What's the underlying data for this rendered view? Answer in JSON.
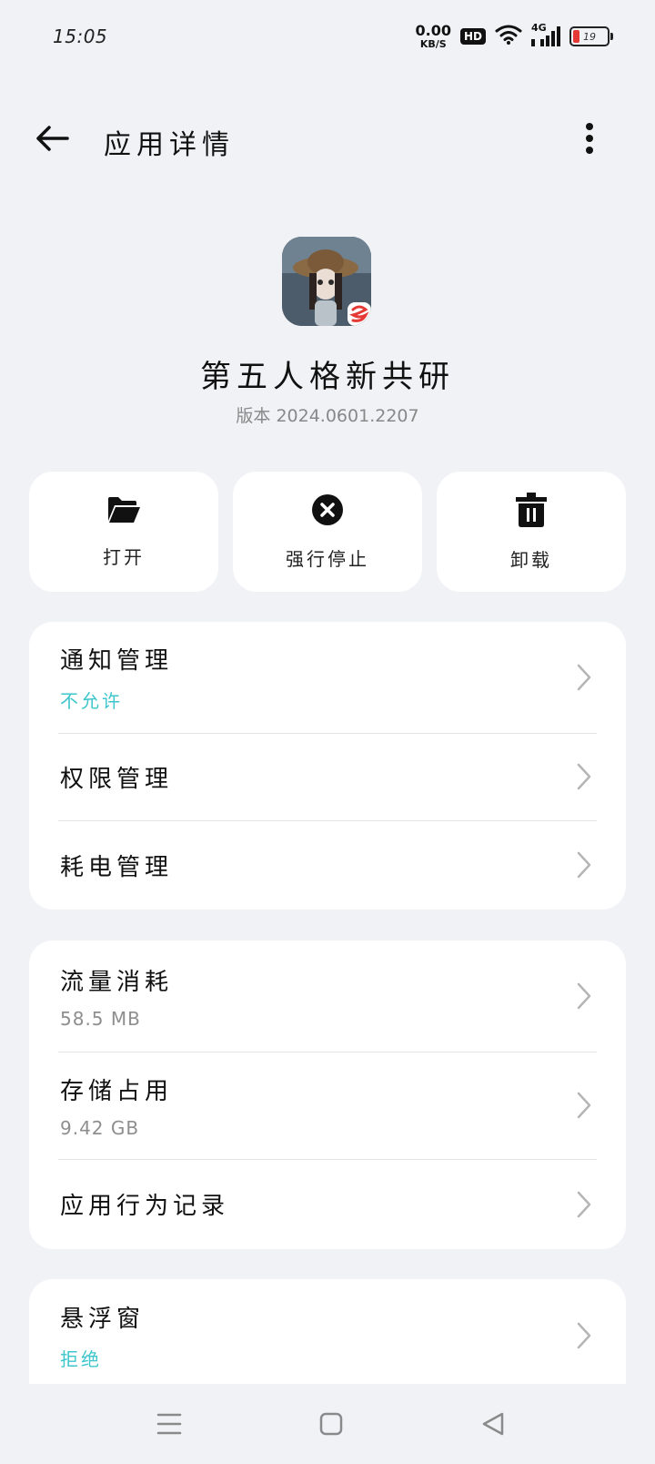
{
  "status_bar": {
    "time": "15:05",
    "net_speed_value": "0.00",
    "net_speed_unit": "KB/S",
    "hd": "HD",
    "network": "4G",
    "battery_level": 19,
    "battery_text": "19",
    "battery_color": "#e53935"
  },
  "header": {
    "title": "应用详情",
    "back_icon": "arrow-left-icon",
    "more_icon": "more-vertical-icon"
  },
  "app": {
    "name": "第五人格新共研",
    "version": "版本 2024.0601.2207"
  },
  "actions": [
    {
      "label": "打开",
      "icon": "folder-open-icon"
    },
    {
      "label": "强行停止",
      "icon": "close-circle-icon"
    },
    {
      "label": "卸载",
      "icon": "trash-icon"
    }
  ],
  "group1": {
    "items": [
      {
        "title": "通知管理",
        "sub": "不允许"
      },
      {
        "title": "权限管理"
      },
      {
        "title": "耗电管理"
      }
    ]
  },
  "group2": {
    "items": [
      {
        "title": "流量消耗",
        "sub": "58.5 MB"
      },
      {
        "title": "存储占用",
        "sub": "9.42 GB"
      },
      {
        "title": "应用行为记录"
      }
    ]
  },
  "group3": {
    "items": [
      {
        "title": "悬浮窗",
        "sub": "拒绝"
      }
    ]
  },
  "colors": {
    "accent": "#3ec6cc",
    "background": "#f1f2f6",
    "card": "#ffffff"
  },
  "nav": {
    "menu_icon": "menu-icon",
    "home_icon": "home-square-icon",
    "back_icon": "back-triangle-icon"
  }
}
